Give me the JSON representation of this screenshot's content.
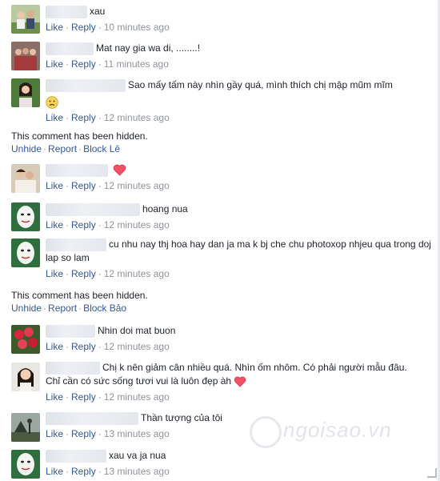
{
  "labels": {
    "like": "Like",
    "reply": "Reply",
    "unhide": "Unhide",
    "report": "Report"
  },
  "hidden_notice": "This comment has been hidden.",
  "comments": [
    {
      "text": "xau",
      "time": "10 minutes ago",
      "avatar": "avatar-couple"
    },
    {
      "text": "Mat nay gia wa di, ........!",
      "time": "11 minutes ago",
      "avatar": "avatar-group"
    },
    {
      "text": "Sao mấy tấm này nhìn gầy quá, mình thích chị mập mũm mĩm",
      "time": "12 minutes ago",
      "avatar": "avatar-woman"
    },
    {
      "text": "",
      "time": "12 minutes ago",
      "avatar": "avatar-couple-2"
    },
    {
      "text": "hoang nua",
      "time": "12 minutes ago",
      "avatar": "avatar-mask"
    },
    {
      "text": "cu nhu nay thj hoa hay dan ja ma k bj che chu photoxop nhjeu qua trong doj lap so lam",
      "time": "12 minutes ago",
      "avatar": "avatar-mask"
    },
    {
      "text": "Nhin doi mat buon",
      "time": "12 minutes ago",
      "avatar": "avatar-roses"
    },
    {
      "text": "Chị k nên giảm cân nhiều quá. Nhìn ốm nhôm. Có phải người mẫu đâu. Chỉ cần có sức sống tươi vui là luôn đẹp àh",
      "time": "12 minutes ago",
      "avatar": "avatar-girl"
    },
    {
      "text": "Thần tượng của tôi",
      "time": "13 minutes ago",
      "avatar": "avatar-landscape"
    },
    {
      "text": "xau va ja nua",
      "time": "13 minutes ago",
      "avatar": "avatar-mask"
    }
  ],
  "hidden": [
    {
      "block_label": "Block Lê"
    },
    {
      "block_label": "Block Bảo"
    }
  ],
  "watermark": "ngoisao.vn",
  "colors": {
    "link": "#365899",
    "meta": "#90949c",
    "text": "#1d2129",
    "heart": "#f25268"
  }
}
